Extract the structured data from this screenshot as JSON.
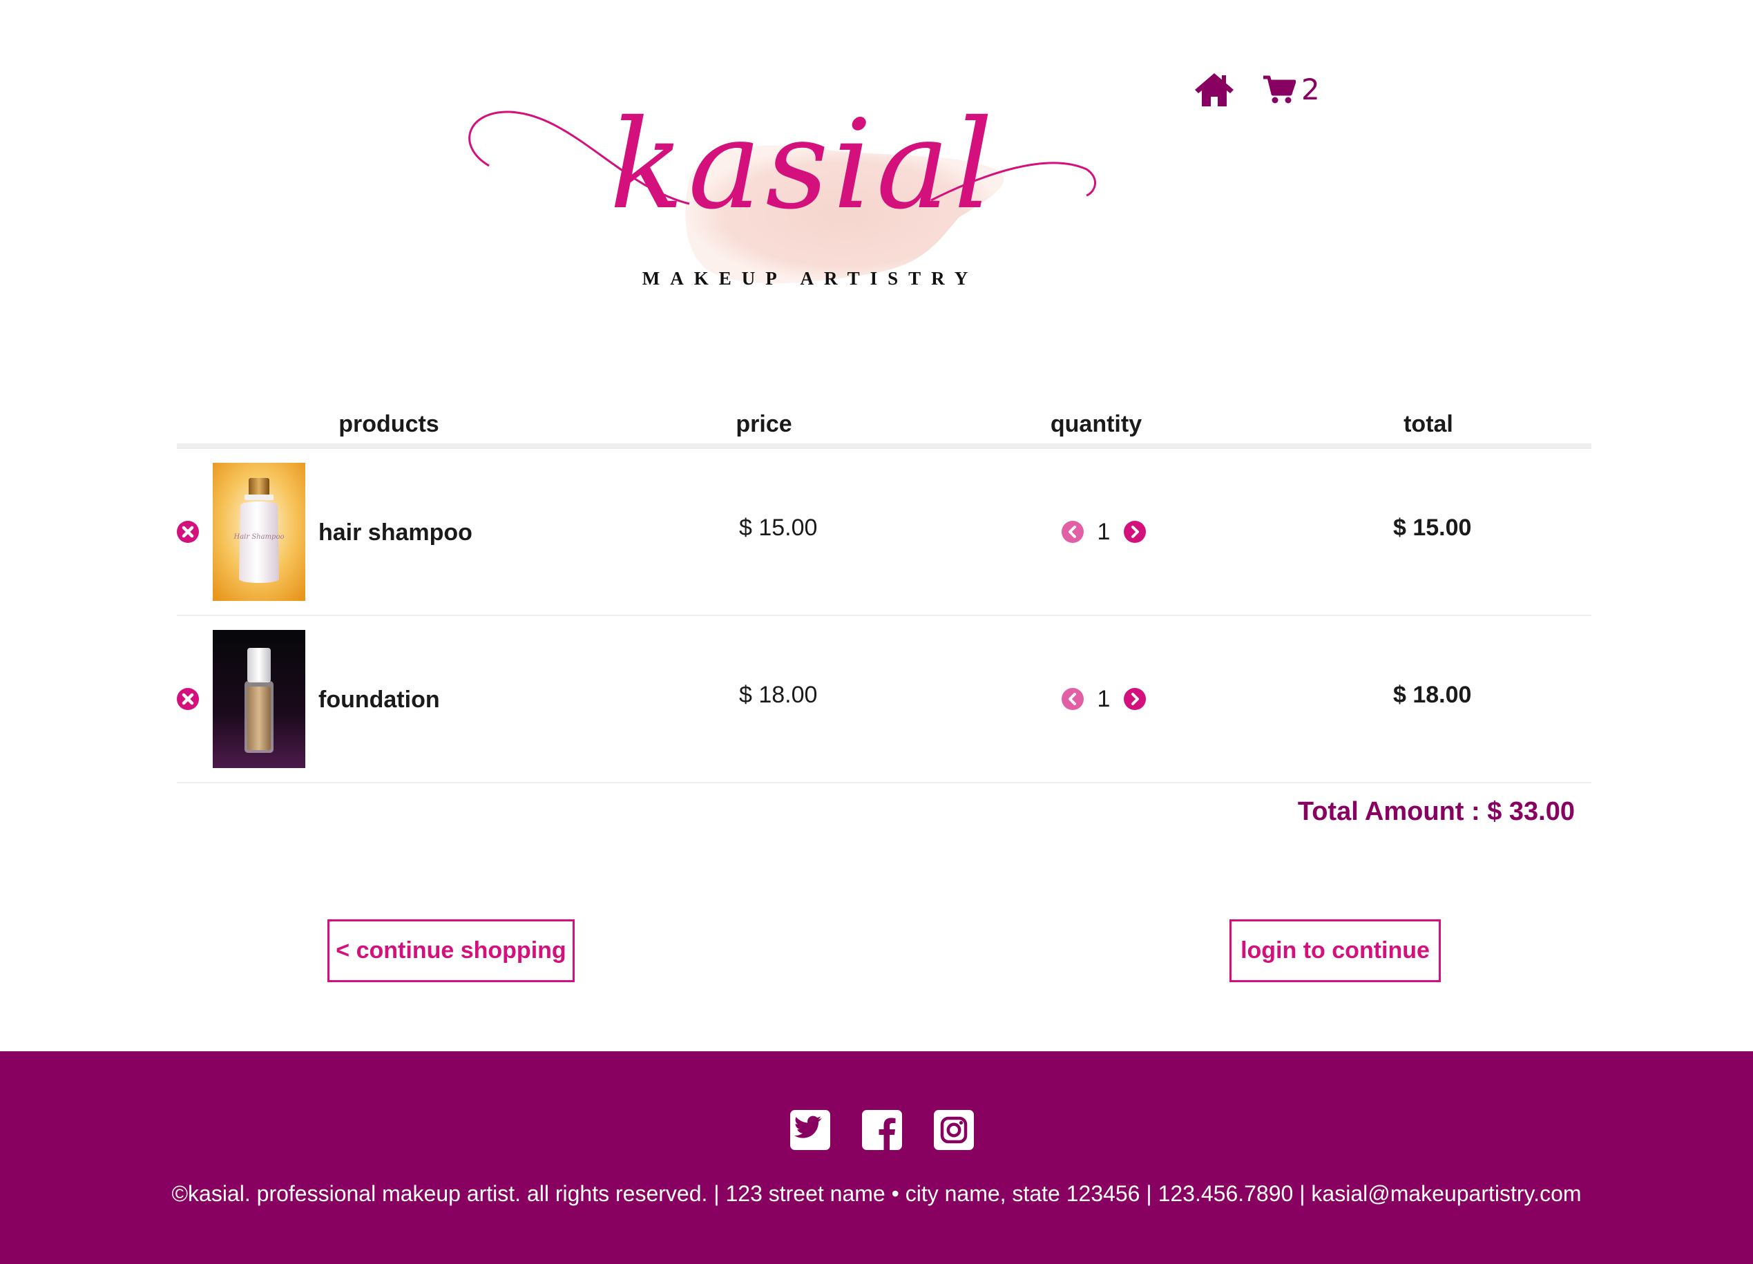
{
  "brand": {
    "logo_word": "kasial",
    "logo_tagline": "MAKEUP ARTISTRY",
    "colors": {
      "primary": "#880060",
      "accent": "#d4107c"
    }
  },
  "header": {
    "home_icon": "home-icon",
    "cart_icon": "shopping-cart-icon",
    "cart_count": "2"
  },
  "cart": {
    "columns": [
      "products",
      "price",
      "quantity",
      "total"
    ],
    "items": [
      {
        "name": "hair shampoo",
        "price": "$ 15.00",
        "quantity": "1",
        "total": "$ 15.00",
        "image": "hair-shampoo-bottle",
        "image_label": "Hair Shampoo"
      },
      {
        "name": "foundation",
        "price": "$ 18.00",
        "quantity": "1",
        "total": "$ 18.00",
        "image": "foundation-bottle"
      }
    ],
    "total_amount": "Total Amount : $ 33.00"
  },
  "actions": {
    "continue_shopping": "< continue shopping",
    "login": "login to continue"
  },
  "footer": {
    "social": [
      "twitter-icon",
      "facebook-icon",
      "instagram-icon"
    ],
    "text": "©kasial. professional makeup artist. all rights reserved. | 123 street name • city name, state 123456 | 123.456.7890 | kasial@makeupartistry.com"
  }
}
